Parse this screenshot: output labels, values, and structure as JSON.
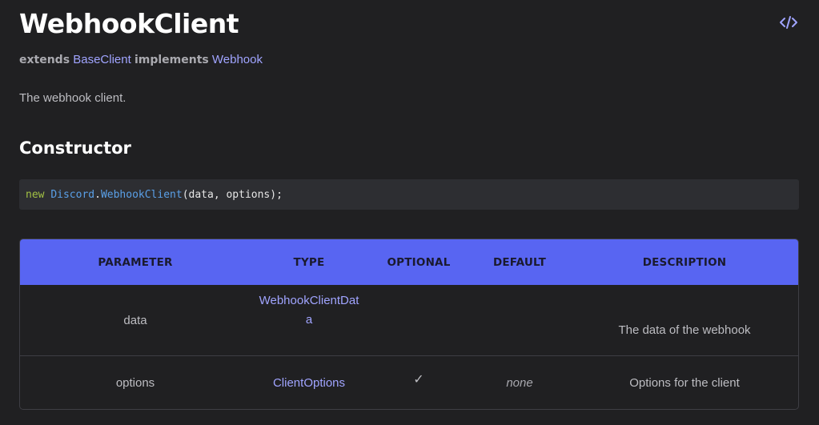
{
  "header": {
    "title": "WebhookClient",
    "source_icon": "code-icon"
  },
  "inheritance": {
    "extends_keyword": "extends",
    "extends_class": "BaseClient",
    "implements_keyword": "implements",
    "implements_class": "Webhook"
  },
  "description": "The webhook client.",
  "constructor": {
    "section_title": "Constructor",
    "code": {
      "keyword": "new",
      "namespace": "Discord",
      "dot": ".",
      "class_name": "WebhookClient",
      "args": "(data, options);"
    }
  },
  "params_table": {
    "headers": {
      "parameter": "PARAMETER",
      "type": "TYPE",
      "optional": "OPTIONAL",
      "default": "DEFAULT",
      "description": "DESCRIPTION"
    },
    "rows": [
      {
        "parameter": "data",
        "type": "WebhookClientData",
        "optional": "",
        "default": "",
        "description": "The data of the webhook"
      },
      {
        "parameter": "options",
        "type": "ClientOptions",
        "optional": "✓",
        "default": "none",
        "description": "Options for the client"
      }
    ]
  },
  "colors": {
    "background": "#202022",
    "accent": "#5865f2",
    "link": "#a0a4ff",
    "code_background": "#2d2e32"
  }
}
